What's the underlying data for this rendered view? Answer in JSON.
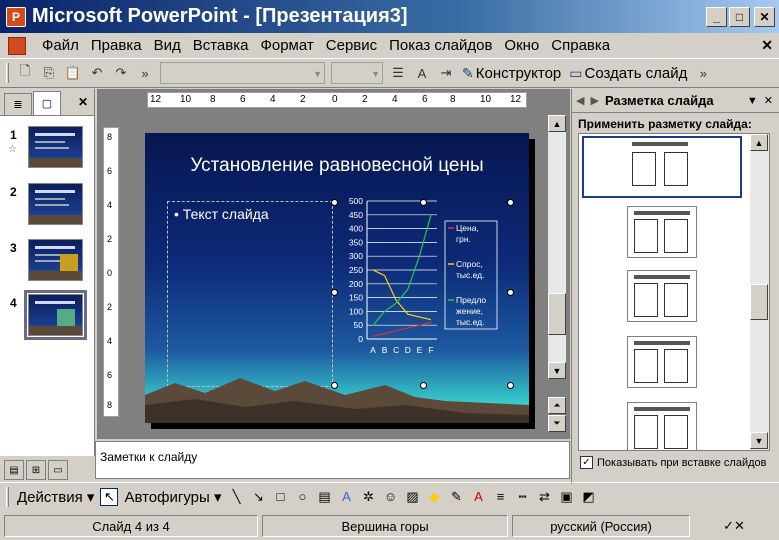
{
  "window": {
    "title": "Microsoft PowerPoint - [Презентация3]",
    "app_icon_letter": "P",
    "minimize": "_",
    "maximize": "□",
    "close": "✕"
  },
  "menu": {
    "items": [
      "Файл",
      "Правка",
      "Вид",
      "Вставка",
      "Формат",
      "Сервис",
      "Показ слайдов",
      "Окно",
      "Справка"
    ],
    "close": "✕"
  },
  "toolbar": {
    "designer_label": "Конструктор",
    "new_slide_label": "Создать слайд",
    "overflow": "»"
  },
  "left_pane": {
    "close": "✕",
    "slides": [
      {
        "num": "1",
        "star": "☆"
      },
      {
        "num": "2"
      },
      {
        "num": "3"
      },
      {
        "num": "4"
      }
    ]
  },
  "slide": {
    "title": "Установление равновесной цены",
    "body_placeholder": "Текст слайда"
  },
  "ruler": {
    "h_labels": [
      "12",
      "10",
      "8",
      "6",
      "4",
      "2",
      "0",
      "2",
      "4",
      "6",
      "8",
      "10",
      "12"
    ],
    "v_labels": [
      "8",
      "6",
      "4",
      "2",
      "0",
      "2",
      "4",
      "6",
      "8"
    ]
  },
  "chart_data": {
    "type": "line",
    "categories": [
      "A",
      "B",
      "C",
      "D",
      "E",
      "F"
    ],
    "ylim": [
      0,
      500
    ],
    "yticks": [
      0,
      50,
      100,
      150,
      200,
      250,
      300,
      350,
      400,
      450,
      500
    ],
    "grid": true,
    "legend_placement": "right",
    "series": [
      {
        "name": "Цена, грн.",
        "values": [
          10,
          20,
          30,
          40,
          50,
          60
        ],
        "color": "#e03030"
      },
      {
        "name": "Спрос, тыс.ед.",
        "values": [
          250,
          230,
          140,
          90,
          80,
          70
        ],
        "color": "#ffd400"
      },
      {
        "name": "Предложение, тыс.ед.",
        "values": [
          50,
          100,
          130,
          180,
          300,
          450
        ],
        "color": "#30c050"
      }
    ],
    "legend_lines": [
      [
        "Цена,",
        "грн."
      ],
      [
        "Спрос,",
        "тыс.ед."
      ],
      [
        "Предло",
        "жение,",
        "тыс.ед."
      ]
    ]
  },
  "notes": {
    "placeholder": "Заметки к слайду"
  },
  "task_pane": {
    "title": "Разметка слайда",
    "section_title": "Применить разметку слайда:",
    "show_on_insert": "Показывать при вставке слайдов",
    "show_on_insert_checked": true
  },
  "draw_toolbar": {
    "actions_label": "Действия",
    "autoshapes_label": "Автофигуры"
  },
  "status": {
    "slide_info": "Слайд 4 из 4",
    "design": "Вершина горы",
    "language": "русский (Россия)"
  }
}
